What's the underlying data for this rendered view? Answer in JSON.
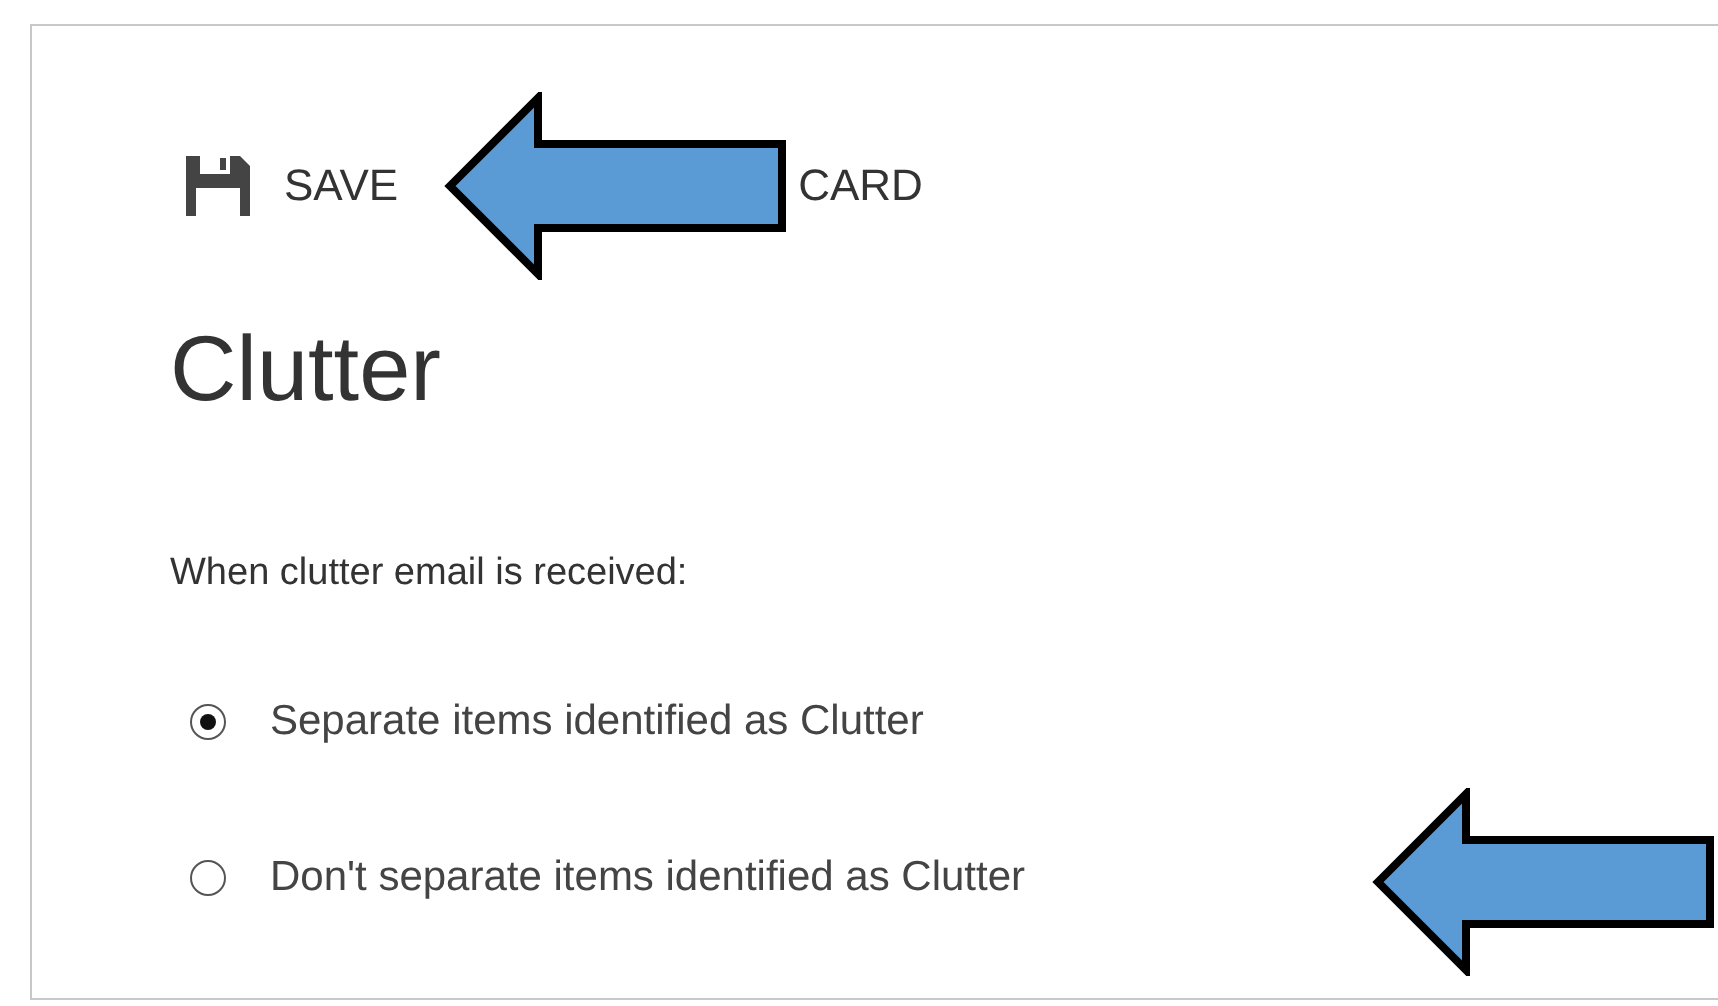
{
  "toolbar": {
    "buttons": [
      {
        "label": "SAVE",
        "kind": "save"
      },
      {
        "label": "CARD",
        "kind": "plain"
      }
    ]
  },
  "title": "Clutter",
  "prompt": "When clutter email is received:",
  "options": [
    {
      "label": "Separate items identified as Clutter",
      "selected": true
    },
    {
      "label": "Don't separate items identified as Clutter",
      "selected": false
    }
  ]
}
